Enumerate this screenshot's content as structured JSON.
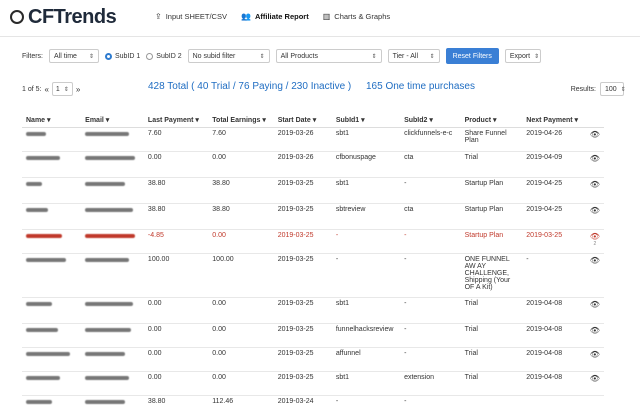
{
  "brand": {
    "name": "CFTrends"
  },
  "nav": [
    {
      "label": "Input SHEET/CSV",
      "icon": "upload-icon"
    },
    {
      "label": "Affiliate Report",
      "icon": "people-icon"
    },
    {
      "label": "Charts & Graphs",
      "icon": "bar-chart-icon"
    }
  ],
  "filters": {
    "label": "Filters:",
    "time": "All time",
    "subid1": "SubID 1",
    "subid2": "SubID 2",
    "subid_filter": "No subid filter",
    "products": "All Products",
    "tier": "Tier - All",
    "reset": "Reset Filters",
    "export": "Export"
  },
  "pager": {
    "text": "1 of 5:",
    "page": "1",
    "first": "«",
    "prev": "‹",
    "next": "›",
    "last": "»"
  },
  "summary": {
    "totals": "428 Total ( 40 Trial / 76 Paying / 230 Inactive )",
    "one_time": "165 One time purchases"
  },
  "results": {
    "label": "Results:",
    "value": "100"
  },
  "table": {
    "columns": [
      "Name",
      "Email",
      "Last Payment",
      "Total Earnings",
      "Start Date",
      "SubId1",
      "SubId2",
      "Product",
      "Next Payment"
    ],
    "rows": [
      {
        "last": "7.60",
        "total": "7.60",
        "start": "2019-03-26",
        "sub1": "sbt1",
        "sub2": "clickfunnels-e-c",
        "product": "Share Funnel Plan",
        "next": "2019-04-26",
        "neg": false
      },
      {
        "last": "0.00",
        "total": "0.00",
        "start": "2019-03-26",
        "sub1": "cfbonuspage",
        "sub2": "cta",
        "product": "Trial",
        "next": "2019-04-09",
        "neg": false
      },
      {
        "last": "38.80",
        "total": "38.80",
        "start": "2019-03-25",
        "sub1": "sbt1",
        "sub2": "-",
        "product": "Startup Plan",
        "next": "2019-04-25",
        "neg": false
      },
      {
        "last": "38.80",
        "total": "38.80",
        "start": "2019-03-25",
        "sub1": "sbtreview",
        "sub2": "cta",
        "product": "Startup Plan",
        "next": "2019-04-25",
        "neg": false
      },
      {
        "last": "-4.85",
        "total": "0.00",
        "start": "2019-03-25",
        "sub1": "-",
        "sub2": "-",
        "product": "Startup Plan",
        "next": "2019-03-25",
        "neg": true,
        "extra": "2"
      },
      {
        "last": "100.00",
        "total": "100.00",
        "start": "2019-03-25",
        "sub1": "-",
        "sub2": "-",
        "product": "ONE FUNNEL AW AY CHALLENGE, Shipping (Your OF A Kit)",
        "next": "-",
        "neg": false
      },
      {
        "last": "0.00",
        "total": "0.00",
        "start": "2019-03-25",
        "sub1": "sbt1",
        "sub2": "-",
        "product": "Trial",
        "next": "2019-04-08",
        "neg": false
      },
      {
        "last": "0.00",
        "total": "0.00",
        "start": "2019-03-25",
        "sub1": "funnelhacksreview",
        "sub2": "-",
        "product": "Trial",
        "next": "2019-04-08",
        "neg": false
      },
      {
        "last": "0.00",
        "total": "0.00",
        "start": "2019-03-25",
        "sub1": "affunnel",
        "sub2": "-",
        "product": "Trial",
        "next": "2019-04-08",
        "neg": false
      },
      {
        "last": "0.00",
        "total": "0.00",
        "start": "2019-03-25",
        "sub1": "sbt1",
        "sub2": "extension",
        "product": "Trial",
        "next": "2019-04-08",
        "neg": false
      },
      {
        "last": "38.80",
        "total": "112.46",
        "start": "2019-03-24",
        "sub1": "-",
        "sub2": "-",
        "product": "",
        "next": "",
        "neg": false
      }
    ]
  }
}
